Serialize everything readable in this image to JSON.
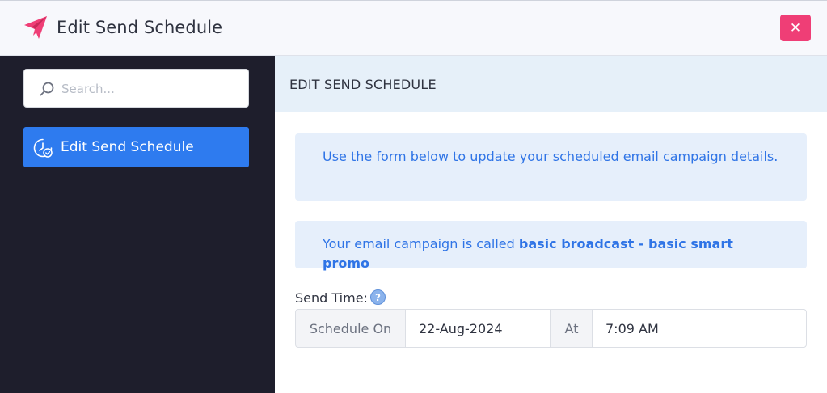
{
  "window": {
    "title": "Edit Send Schedule",
    "close_label": "✕",
    "title_icon": "paper-plane-icon",
    "accent_color": "#ef3e76"
  },
  "sidebar": {
    "search_placeholder": "Search...",
    "items": [
      {
        "label": "Edit Send Schedule",
        "icon": "clock-check-icon",
        "active": true
      }
    ],
    "active_color": "#2e7bef"
  },
  "main": {
    "section_title": "EDIT SEND SCHEDULE",
    "info_text": "Use the form below to update your scheduled email campaign details.",
    "campaign_prefix": "Your email campaign is called ",
    "campaign_name": "basic broadcast - basic smart promo",
    "send_time_label": "Send Time:",
    "help_label": "?",
    "schedule_on_label": "Schedule On",
    "date_value": "22-Aug-2024",
    "at_label": "At",
    "time_value": "7:09 AM"
  }
}
